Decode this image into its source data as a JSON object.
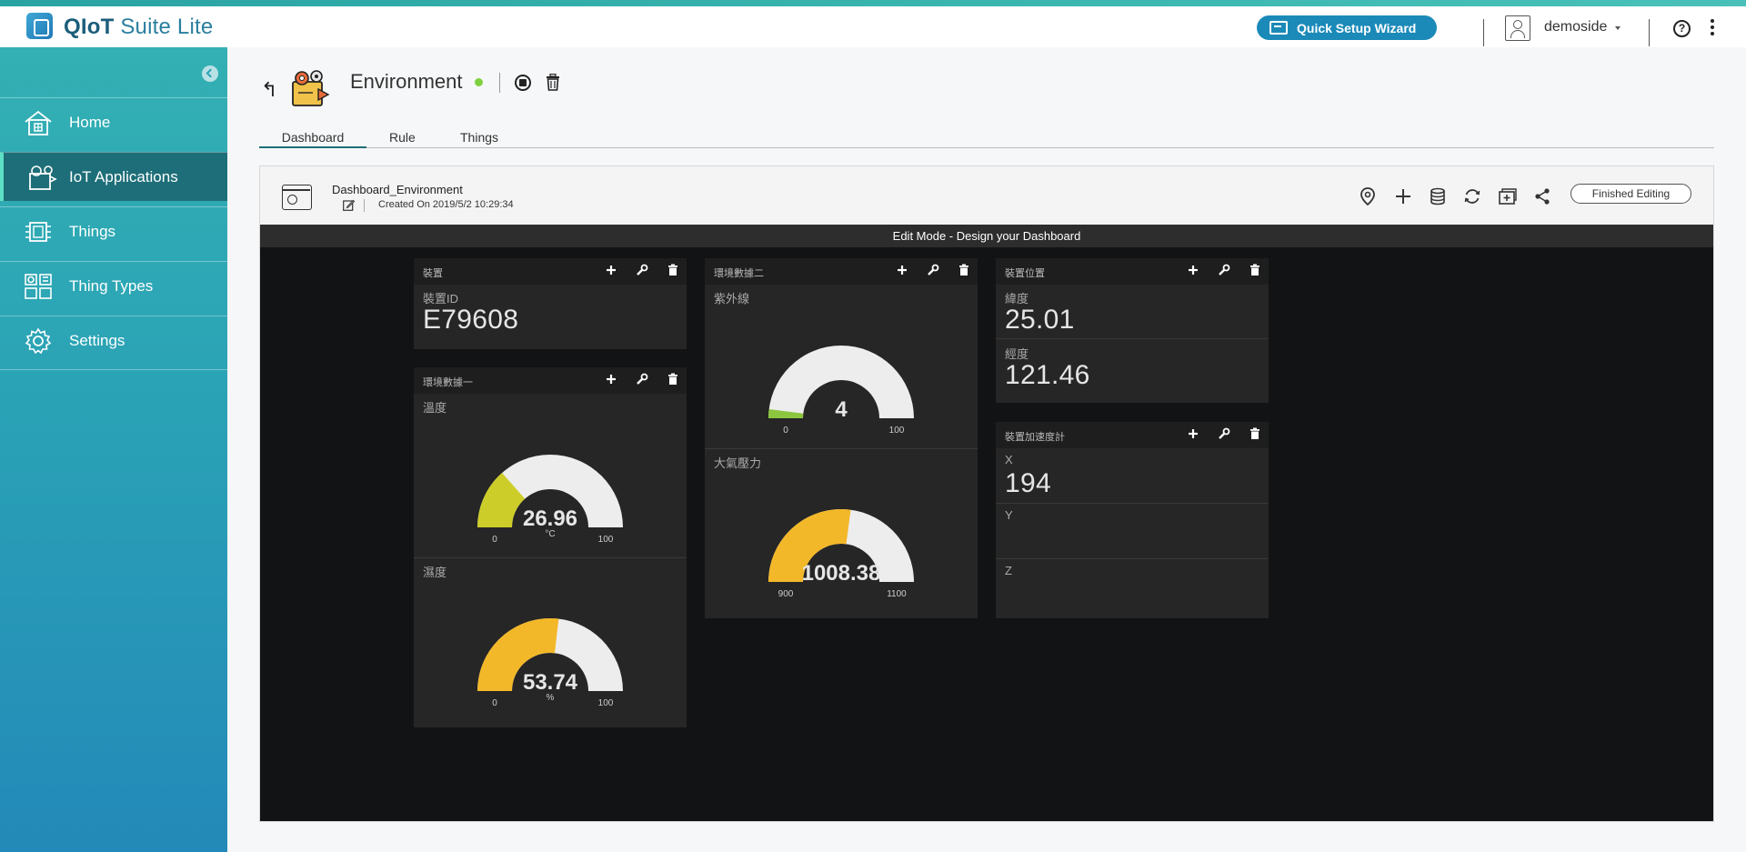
{
  "header": {
    "app_name_bold": "QIoT",
    "app_name_rest": "Suite Lite",
    "wizard_label": "Quick Setup Wizard",
    "username": "demoside",
    "help_label": "?"
  },
  "sidebar": {
    "items": [
      {
        "label": "Home",
        "icon": "home-icon"
      },
      {
        "label": "IoT Applications",
        "icon": "iot-applications-icon",
        "active": true
      },
      {
        "label": "Things",
        "icon": "chip-icon"
      },
      {
        "label": "Thing Types",
        "icon": "thing-types-icon"
      },
      {
        "label": "Settings",
        "icon": "gear-icon"
      }
    ]
  },
  "page": {
    "title": "Environment",
    "status_color": "#7ed040",
    "tabs": [
      "Dashboard",
      "Rule",
      "Things"
    ],
    "active_tab": "Dashboard"
  },
  "dashboard": {
    "name": "Dashboard_Environment",
    "created": "Created On 2019/5/2 10:29:34",
    "finish_label": "Finished Editing",
    "edit_mode_text": "Edit Mode - Design your Dashboard",
    "toolbar_icons": [
      "location-icon",
      "add-icon",
      "database-icon",
      "refresh-icon",
      "add-widget-icon",
      "share-icon"
    ]
  },
  "widgets": {
    "device": {
      "title": "裝置",
      "id_label": "裝置ID",
      "id_value": "E79608"
    },
    "env1": {
      "title": "環境數據一",
      "temp": {
        "label": "溫度",
        "value": "26.96",
        "value_num": 26.96,
        "unit": "°C",
        "min": "0",
        "max": "100",
        "min_num": 0,
        "max_num": 100,
        "color": "#cdcd2a"
      },
      "humidity": {
        "label": "濕度",
        "value": "53.74",
        "value_num": 53.74,
        "unit": "%",
        "min": "0",
        "max": "100",
        "min_num": 0,
        "max_num": 100,
        "color": "#f3b829"
      }
    },
    "env2": {
      "title": "環境數據二",
      "uv": {
        "label": "紫外線",
        "value": "4",
        "value_num": 4,
        "unit": "",
        "min": "0",
        "max": "100",
        "min_num": 0,
        "max_num": 100,
        "color": "#8cc63f"
      },
      "pressure": {
        "label": "大氣壓力",
        "value": "1008.38",
        "value_num": 1008.38,
        "unit": "",
        "min": "900",
        "max": "1100",
        "min_num": 900,
        "max_num": 1100,
        "color": "#f3b829"
      }
    },
    "location": {
      "title": "裝置位置",
      "lat_label": "緯度",
      "lat_value": "25.01",
      "lng_label": "經度",
      "lng_value": "121.46"
    },
    "accel": {
      "title": "裝置加速度計",
      "x_label": "X",
      "x_value": "194",
      "y_label": "Y",
      "y_value": "",
      "z_label": "Z",
      "z_value": ""
    }
  }
}
